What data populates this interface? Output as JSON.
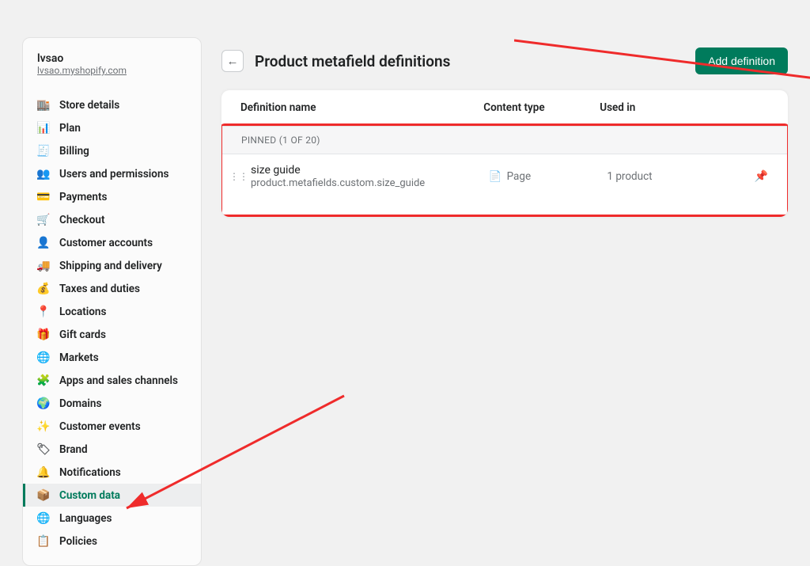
{
  "sidebar": {
    "store_name": "lvsao",
    "store_url": "lvsao.myshopify.com",
    "items": [
      {
        "icon": "🏬",
        "label": "Store details"
      },
      {
        "icon": "📊",
        "label": "Plan"
      },
      {
        "icon": "🧾",
        "label": "Billing"
      },
      {
        "icon": "👥",
        "label": "Users and permissions"
      },
      {
        "icon": "💳",
        "label": "Payments"
      },
      {
        "icon": "🛒",
        "label": "Checkout"
      },
      {
        "icon": "👤",
        "label": "Customer accounts"
      },
      {
        "icon": "🚚",
        "label": "Shipping and delivery"
      },
      {
        "icon": "💰",
        "label": "Taxes and duties"
      },
      {
        "icon": "📍",
        "label": "Locations"
      },
      {
        "icon": "🎁",
        "label": "Gift cards"
      },
      {
        "icon": "🌐",
        "label": "Markets"
      },
      {
        "icon": "🧩",
        "label": "Apps and sales channels"
      },
      {
        "icon": "🌍",
        "label": "Domains"
      },
      {
        "icon": "✨",
        "label": "Customer events"
      },
      {
        "icon": "🏷",
        "label": "Brand"
      },
      {
        "icon": "🔔",
        "label": "Notifications"
      },
      {
        "icon": "📦",
        "label": "Custom data",
        "active": true
      },
      {
        "icon": "🌐",
        "label": "Languages"
      },
      {
        "icon": "📋",
        "label": "Policies"
      }
    ]
  },
  "header": {
    "title": "Product metafield definitions",
    "add_button": "Add definition"
  },
  "table": {
    "columns": {
      "name": "Definition name",
      "type": "Content type",
      "used": "Used in"
    },
    "pinned_label": "PINNED (1 OF 20)",
    "rows": [
      {
        "name": "size guide",
        "key": "product.metafields.custom.size_guide",
        "type_icon": "📄",
        "type": "Page",
        "used": "1 product"
      }
    ]
  }
}
